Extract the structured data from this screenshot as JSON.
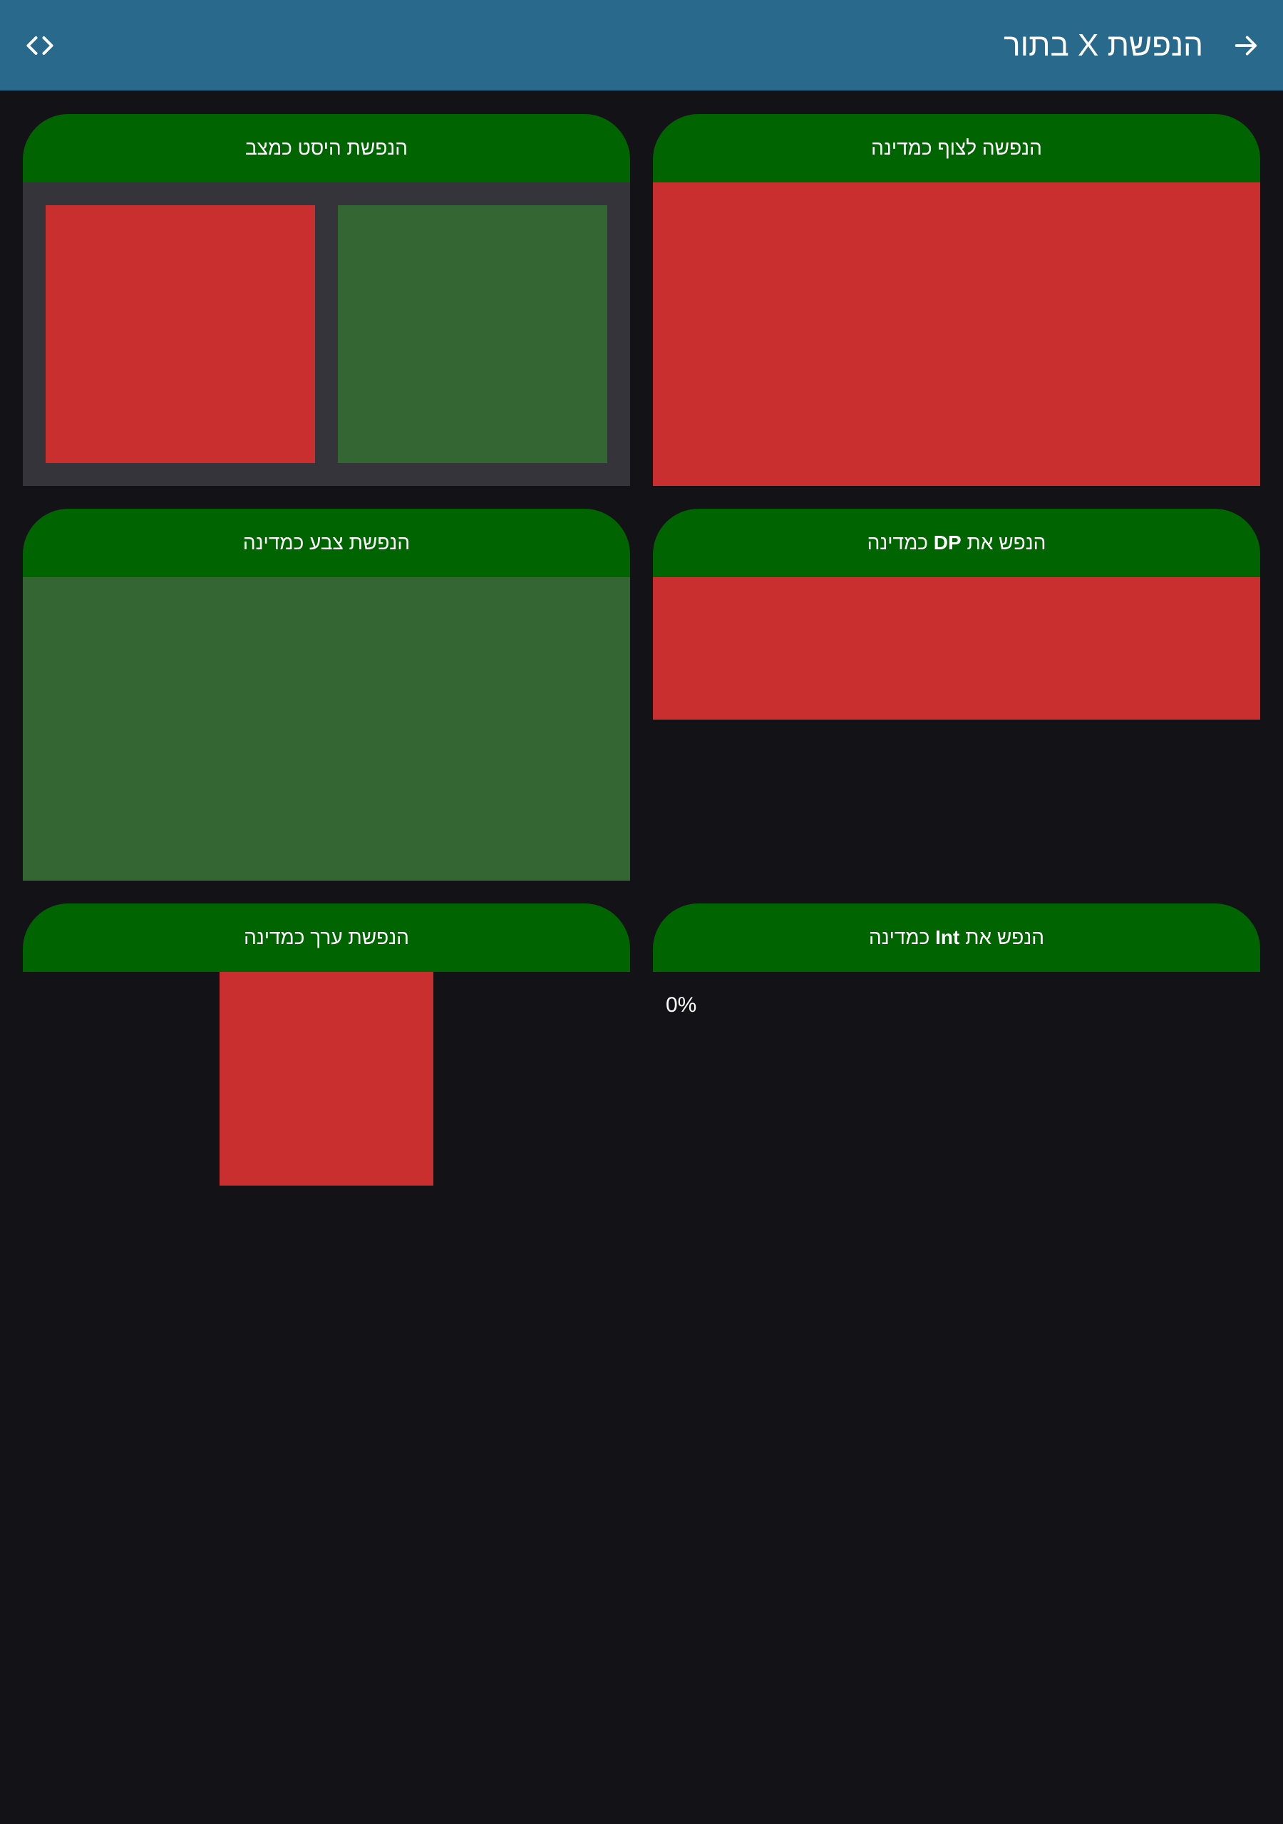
{
  "appbar": {
    "title": "הנפשת X בתור",
    "back_icon": "arrow-right-icon",
    "code_icon": "code-brackets-icon",
    "background": "#296a8c"
  },
  "cards": {
    "pulse_state": {
      "title": "הנפשה לצוף כמדינה",
      "color": "#c92f2f"
    },
    "history_state": {
      "title": "הנפשת היסט כמצב",
      "squares": [
        {
          "color": "#c92f2f"
        },
        {
          "color": "#336633"
        }
      ]
    },
    "dp_state": {
      "title_prefix": "הנפש את",
      "title_bold": "DP",
      "title_suffix": "כמדינה",
      "color": "#c92f2f"
    },
    "color_state": {
      "title": "הנפשת צבע כמדינה",
      "color": "#336633"
    },
    "int_state": {
      "title_prefix": "הנפש את",
      "title_bold": "Int",
      "title_suffix": "כמדינה",
      "value": "0%"
    },
    "value_state": {
      "title": "הנפשת ערך כמדינה",
      "color": "#c92f2f"
    }
  },
  "colors": {
    "card_header": "#006400",
    "page_background": "#131317",
    "panel_background": "#35343b"
  }
}
